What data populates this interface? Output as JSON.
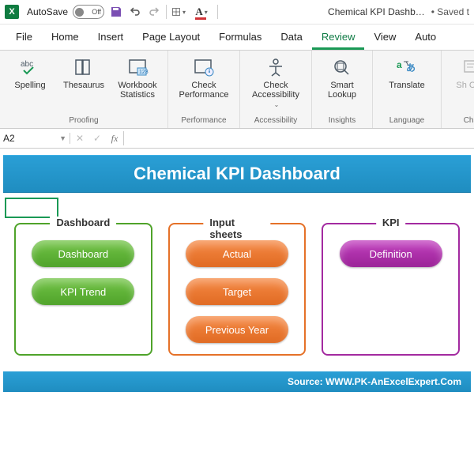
{
  "qat": {
    "autosave_label": "AutoSave",
    "autosave_state": "Off",
    "title": "Chemical KPI Dashb…",
    "status": "• Saved t"
  },
  "tabs": {
    "file": "File",
    "home": "Home",
    "insert": "Insert",
    "page_layout": "Page Layout",
    "formulas": "Formulas",
    "data": "Data",
    "review": "Review",
    "view": "View",
    "auto": "Auto"
  },
  "ribbon": {
    "proofing": {
      "spelling": "Spelling",
      "thesaurus": "Thesaurus",
      "workbook_statistics": "Workbook Statistics",
      "label": "Proofing"
    },
    "performance": {
      "check_performance": "Check Performance",
      "label": "Performance"
    },
    "accessibility": {
      "check_accessibility": "Check Accessibility",
      "label": "Accessibility"
    },
    "insights": {
      "smart_lookup": "Smart Lookup",
      "label": "Insights"
    },
    "language": {
      "translate": "Translate",
      "label": "Language"
    },
    "changes": {
      "show_changes": "Sh Chai",
      "label": "Chai"
    }
  },
  "formula_bar": {
    "name_box": "A2",
    "fx": "fx"
  },
  "sheet": {
    "title": "Chemical KPI Dashboard",
    "footer": "Source: WWW.PK-AnExcelExpert.Com",
    "panels": {
      "dashboard": {
        "legend": "Dashboard",
        "btn1": "Dashboard",
        "btn2": "KPI Trend"
      },
      "input": {
        "legend": "Input sheets",
        "btn1": "Actual",
        "btn2": "Target",
        "btn3": "Previous Year"
      },
      "kpi": {
        "legend": "KPI",
        "btn1": "Definition"
      }
    }
  }
}
